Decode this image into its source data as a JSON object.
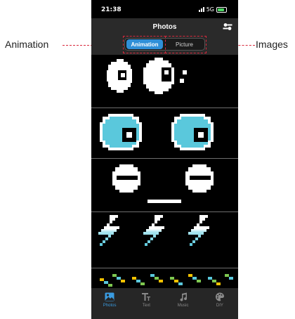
{
  "status_bar": {
    "time": "21:38",
    "network": "5G"
  },
  "nav": {
    "title": "Photos",
    "settings_icon": "settings-sliders-icon"
  },
  "segmented": {
    "animation_label": "Animation",
    "picture_label": "Picture",
    "selected": "Animation"
  },
  "callouts": {
    "left_label": "Animation",
    "right_label": "Images"
  },
  "gallery": [
    {
      "name": "rolling-eyes",
      "colors": [
        "#ffffff"
      ]
    },
    {
      "name": "cyan-eyes",
      "colors": [
        "#5ac8dc"
      ]
    },
    {
      "name": "sleepy-face",
      "colors": [
        "#ffffff"
      ]
    },
    {
      "name": "lightning-bolts",
      "colors": [
        "#ffffff",
        "#a8e4ee",
        "#5ac8dc"
      ]
    },
    {
      "name": "diagonal-stripes",
      "colors": [
        "#f2c200",
        "#5ac8dc",
        "#7ec850"
      ]
    }
  ],
  "tabs": [
    {
      "label": "Photos",
      "icon": "photos-icon",
      "active": true
    },
    {
      "label": "Text",
      "icon": "text-icon",
      "active": false
    },
    {
      "label": "Music",
      "icon": "music-note-icon",
      "active": false
    },
    {
      "label": "DIY",
      "icon": "palette-icon",
      "active": false
    }
  ],
  "colors": {
    "accent": "#2f8fd8",
    "callout": "#d8283c",
    "nav_bg": "#2a2a2a",
    "tab_bg": "#262626"
  }
}
